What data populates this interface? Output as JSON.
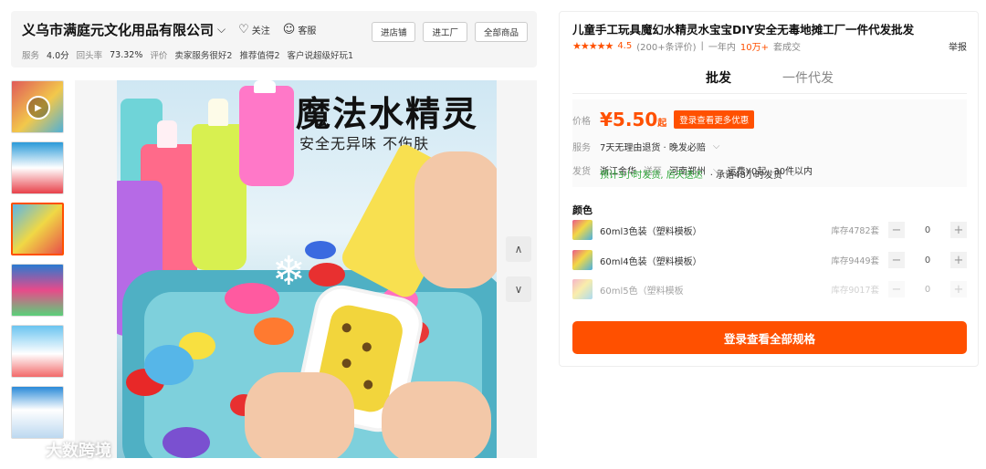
{
  "shop": {
    "name": "义乌市满庭元文化用品有限公司",
    "follow_label": "关注",
    "service_label": "客服",
    "stats": {
      "service_label": "服务",
      "service_score": "4.0分",
      "repurchase_label": "回头率",
      "repurchase_rate": "73.32%",
      "review_label": "评价",
      "review_tags": [
        "卖家服务很好2",
        "推荐值得2",
        "客户说超级好玩1"
      ]
    },
    "buttons": [
      "进店铺",
      "进工厂",
      "全部商品"
    ]
  },
  "gallery": {
    "main_title": "魔法水精灵",
    "main_subtitle": "安全无异味 不伤肤",
    "nav_up": "∧",
    "nav_down": "∨"
  },
  "watermark": {
    "text": "大数跨境"
  },
  "product": {
    "title": "儿童手工玩具魔幻水精灵水宝宝DIY安全无毒地摊工厂一件代发批发",
    "stars": "★★★★★",
    "rating": "4.5",
    "review_count": "(200+条评价)",
    "sales_prefix": "一年内",
    "sales_value": "10万+",
    "sales_suffix": "套成交",
    "report_label": "举报",
    "tabs": [
      "批发",
      "一件代发"
    ],
    "price_label": "价格",
    "price_symbol": "¥",
    "price_value": "5.50",
    "price_suffix": "起",
    "price_promo": "登录查看更多优惠",
    "service_label": "服务",
    "service_text": "7天无理由退货 · 晚发必赔",
    "ship_label": "发货",
    "ship_from": "浙江金华",
    "ship_to_word": "送至",
    "ship_to": "河南郑州",
    "ship_fee": "运费¥0起",
    "ship_moq": "30件以内",
    "ship_promise": "预计3小时发货, 后天送达",
    "ship_promise2": "· 承诺48小时发货",
    "color_title": "颜色",
    "skus": [
      {
        "name": "60ml3色装（塑料模板）",
        "stock": "库存4782套",
        "qty": "0"
      },
      {
        "name": "60ml4色装（塑料模板）",
        "stock": "库存9449套",
        "qty": "0"
      },
      {
        "name": "60ml5色（塑料模板",
        "stock": "库存9017套",
        "qty": "0"
      }
    ],
    "cta_label": "登录查看全部规格"
  }
}
